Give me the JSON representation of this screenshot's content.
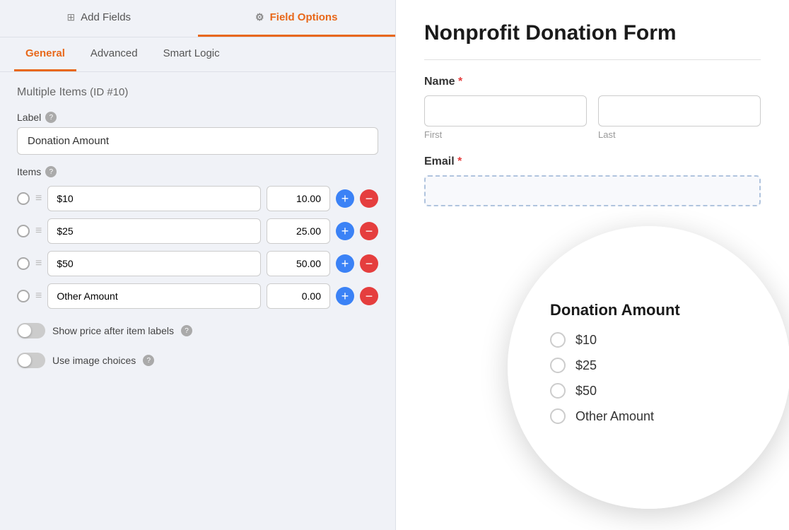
{
  "left_panel": {
    "top_tabs": [
      {
        "id": "add-fields",
        "label": "Add Fields",
        "icon": "⊞",
        "active": false
      },
      {
        "id": "field-options",
        "label": "Field Options",
        "icon": "⚙",
        "active": true
      }
    ],
    "sub_tabs": [
      {
        "id": "general",
        "label": "General",
        "active": true
      },
      {
        "id": "advanced",
        "label": "Advanced",
        "active": false
      },
      {
        "id": "smart-logic",
        "label": "Smart Logic",
        "active": false
      }
    ],
    "field_title": "Multiple Items",
    "field_id": "(ID #10)",
    "label_section": {
      "label": "Label",
      "help": "?",
      "value": "Donation Amount"
    },
    "items_section": {
      "label": "Items",
      "help": "?",
      "items": [
        {
          "name": "$10",
          "price": "10.00"
        },
        {
          "name": "$25",
          "price": "25.00"
        },
        {
          "name": "$50",
          "price": "50.00"
        },
        {
          "name": "Other Amount",
          "price": "0.00"
        }
      ]
    },
    "toggles": [
      {
        "label": "Show price after item labels",
        "help": "?",
        "on": false
      },
      {
        "label": "Use image choices",
        "help": "?",
        "on": false
      }
    ],
    "buttons": {
      "add": "+",
      "remove": "−"
    }
  },
  "right_panel": {
    "form_title": "Nonprofit Donation Form",
    "fields": [
      {
        "label": "Name",
        "required": true,
        "type": "name",
        "subfields": [
          "First",
          "Last"
        ]
      },
      {
        "label": "Email",
        "required": true,
        "type": "email"
      }
    ],
    "zoom": {
      "section_title": "Donation Amount",
      "items": [
        "$10",
        "$25",
        "$50",
        "Other Amount"
      ]
    }
  }
}
